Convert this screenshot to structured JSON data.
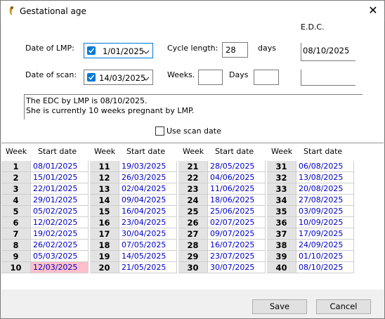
{
  "window": {
    "title": "Gestational age",
    "close_glyph": "✕"
  },
  "form": {
    "lmp_label": "Date of LMP:",
    "lmp_value": "1/01/2025",
    "scan_label": "Date of scan:",
    "scan_value": "14/03/2025",
    "cycle_label": "Cycle length:",
    "cycle_value": "28",
    "days_unit": "days",
    "weeks_label": "Weeks.",
    "weeks_value": "",
    "days_label": "Days",
    "days_value": "",
    "edc_label": "E.D.C.",
    "edc_value": "08/10/2025",
    "edc_scan_value": ""
  },
  "message": {
    "line1": "The EDC by LMP is 08/10/2025.",
    "line2": " She is currently 10 weeks pregnant by LMP."
  },
  "use_scan_label": "Use scan date",
  "grid": {
    "col_week": "Week",
    "col_start": "Start date",
    "highlight_week": 10,
    "columns": [
      [
        [
          "1",
          "08/01/2025"
        ],
        [
          "2",
          "15/01/2025"
        ],
        [
          "3",
          "22/01/2025"
        ],
        [
          "4",
          "29/01/2025"
        ],
        [
          "5",
          "05/02/2025"
        ],
        [
          "6",
          "12/02/2025"
        ],
        [
          "7",
          "19/02/2025"
        ],
        [
          "8",
          "26/02/2025"
        ],
        [
          "9",
          "05/03/2025"
        ],
        [
          "10",
          "12/03/2025"
        ]
      ],
      [
        [
          "11",
          "19/03/2025"
        ],
        [
          "12",
          "26/03/2025"
        ],
        [
          "13",
          "02/04/2025"
        ],
        [
          "14",
          "09/04/2025"
        ],
        [
          "15",
          "16/04/2025"
        ],
        [
          "16",
          "23/04/2025"
        ],
        [
          "17",
          "30/04/2025"
        ],
        [
          "18",
          "07/05/2025"
        ],
        [
          "19",
          "14/05/2025"
        ],
        [
          "20",
          "21/05/2025"
        ]
      ],
      [
        [
          "21",
          "28/05/2025"
        ],
        [
          "22",
          "04/06/2025"
        ],
        [
          "23",
          "11/06/2025"
        ],
        [
          "24",
          "18/06/2025"
        ],
        [
          "25",
          "25/06/2025"
        ],
        [
          "26",
          "02/07/2025"
        ],
        [
          "27",
          "09/07/2025"
        ],
        [
          "28",
          "16/07/2025"
        ],
        [
          "29",
          "23/07/2025"
        ],
        [
          "30",
          "30/07/2025"
        ]
      ],
      [
        [
          "31",
          "06/08/2025"
        ],
        [
          "32",
          "13/08/2025"
        ],
        [
          "33",
          "20/08/2025"
        ],
        [
          "34",
          "27/08/2025"
        ],
        [
          "35",
          "03/09/2025"
        ],
        [
          "36",
          "10/09/2025"
        ],
        [
          "37",
          "17/09/2025"
        ],
        [
          "38",
          "24/09/2025"
        ],
        [
          "39",
          "01/10/2025"
        ],
        [
          "40",
          "08/10/2025"
        ]
      ]
    ]
  },
  "buttons": {
    "save": "Save",
    "cancel": "Cancel"
  },
  "colors": {
    "accent": "#0078d7",
    "date_text": "#0000c8",
    "highlight": "#ffc0cb"
  }
}
